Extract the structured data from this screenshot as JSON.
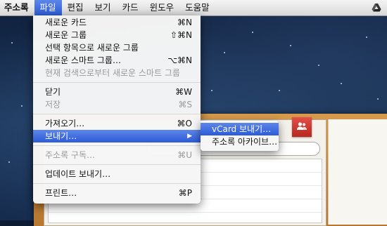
{
  "menubar": {
    "app_name": "주소록",
    "items": [
      "파일",
      "편집",
      "보기",
      "카드",
      "윈도우",
      "도움말"
    ],
    "active_index": 0
  },
  "file_menu": {
    "groups": [
      [
        {
          "label": "새로운 카드",
          "shortcut": "⌘N",
          "disabled": false
        },
        {
          "label": "새로운 그룹",
          "shortcut": "⇧⌘N",
          "disabled": false
        },
        {
          "label": "선택 항목으로 새로운 그룹",
          "shortcut": "",
          "disabled": false
        },
        {
          "label": "새로운 스마트 그룹…",
          "shortcut": "⌥⌘N",
          "disabled": false
        },
        {
          "label": "현재 검색으로부터 새로운 스마트 그룹",
          "shortcut": "",
          "disabled": true
        }
      ],
      [
        {
          "label": "닫기",
          "shortcut": "⌘W",
          "disabled": false
        },
        {
          "label": "저장",
          "shortcut": "⌘S",
          "disabled": true
        }
      ],
      [
        {
          "label": "가져오기…",
          "shortcut": "⌘O",
          "disabled": false
        },
        {
          "label": "보내기…",
          "shortcut": "",
          "disabled": false,
          "highlighted": true,
          "has_submenu": true
        }
      ],
      [
        {
          "label": "주소록 구독…",
          "shortcut": "⌘U",
          "disabled": true
        }
      ],
      [
        {
          "label": "업데이트 보내기…",
          "shortcut": "",
          "disabled": false
        }
      ],
      [
        {
          "label": "프린트…",
          "shortcut": "⌘P",
          "disabled": false
        }
      ]
    ]
  },
  "export_submenu": {
    "items": [
      {
        "label": "vCard 보내기…",
        "highlighted": true
      },
      {
        "label": "주소록 아카이브…",
        "highlighted": false
      }
    ]
  },
  "icons": {
    "menubar_right": "google-drive-icon",
    "ribbon": "group-icon",
    "submenu_arrow": "triangle-right-icon"
  },
  "colors": {
    "highlight": "#2f5ed6",
    "ribbon": "#c8342b"
  }
}
